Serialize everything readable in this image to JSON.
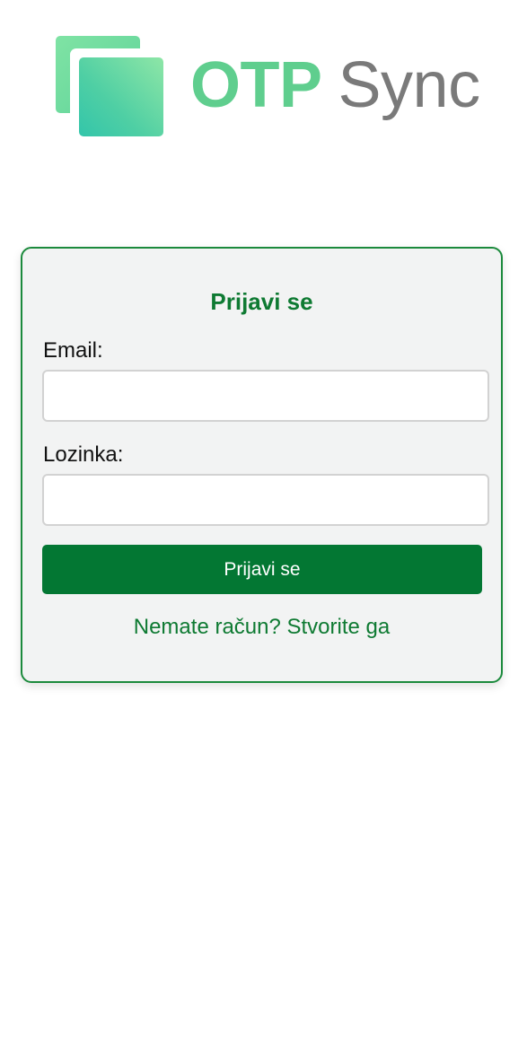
{
  "header": {
    "brand_primary": "OTP",
    "brand_secondary": "Sync",
    "logo_icon": "stacked-squares-icon"
  },
  "login": {
    "title": "Prijavi se",
    "email_label": "Email:",
    "email_value": "",
    "password_label": "Lozinka:",
    "password_value": "",
    "submit_label": "Prijavi se",
    "signup_link": "Nemate račun? Stvorite ga"
  },
  "colors": {
    "accent": "#037733",
    "brand_green": "#5fce8e",
    "brand_gray": "#7a7a7a",
    "card_background": "#f2f3f3",
    "card_border": "#1b8a3c"
  }
}
